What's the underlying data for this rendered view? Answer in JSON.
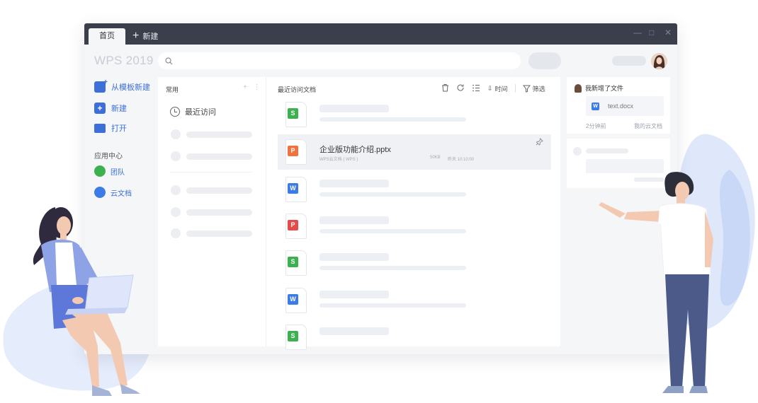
{
  "window": {
    "tab_home": "首页",
    "tab_new": "新建",
    "brand": "WPS 2019"
  },
  "nav": {
    "items": [
      {
        "label": "从模板新建",
        "icon": "template-new-icon"
      },
      {
        "label": "新建",
        "icon": "plus-icon"
      },
      {
        "label": "打开",
        "icon": "folder-icon"
      }
    ],
    "apps_title": "应用中心",
    "apps": [
      {
        "label": "团队",
        "icon": "team-icon"
      },
      {
        "label": "云文档",
        "icon": "cloud-doc-icon"
      }
    ]
  },
  "left_panel": {
    "title": "常用",
    "recent_label": "最近访问"
  },
  "main": {
    "title": "最近访问文档",
    "sort_label": "时间",
    "filter_label": "筛选",
    "selected_file": {
      "name": "企业版功能介绍.pptx",
      "location": "WPS云文档 ( WPS )",
      "size": "50KB",
      "time": "昨天 10:10:00"
    },
    "file_types": [
      "S",
      "P",
      "W",
      "P",
      "S",
      "W",
      "S"
    ]
  },
  "activity": {
    "title": "我新增了文件",
    "file_name": "text.docx",
    "time": "2分钟前",
    "location": "我的云文档"
  },
  "colors": {
    "titlebar": "#3b3f4c",
    "accent": "#3d6fd8",
    "sheet": "#3db14f",
    "presentation": "#f0733e",
    "writer": "#3d7ce8",
    "pdf": "#e54b4b"
  }
}
